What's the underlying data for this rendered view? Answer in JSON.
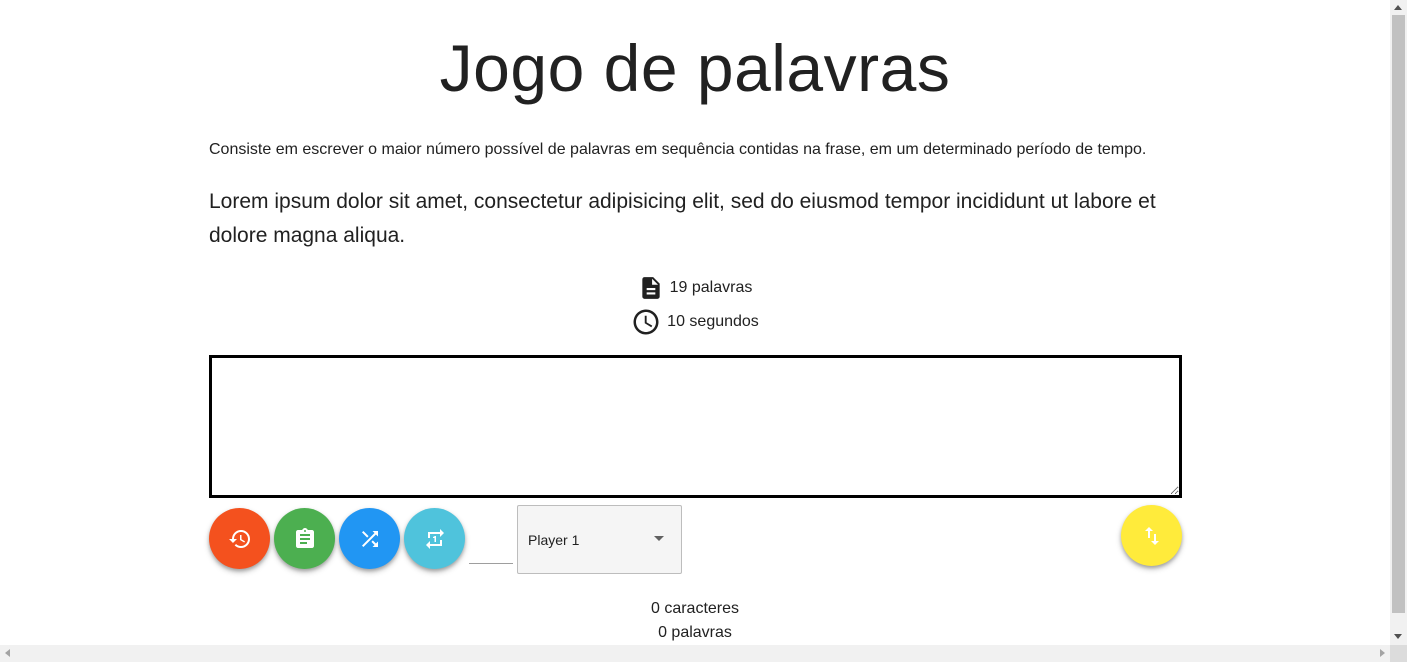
{
  "page": {
    "title": "Jogo de palavras",
    "description": "Consiste em escrever o maior número possível de palavras em sequência contidas na frase, em um determinado período de tempo.",
    "phrase": "Lorem ipsum dolor sit amet, consectetur adipisicing elit, sed do eiusmod tempor incididunt ut labore et dolore magna aliqua."
  },
  "stats": {
    "words": "19 palavras",
    "words_icon": "document-icon",
    "time": "10 segundos",
    "time_icon": "clock-icon"
  },
  "typing": {
    "value": "",
    "placeholder": ""
  },
  "actions": {
    "history": {
      "icon": "history-icon",
      "color": "#f4511e"
    },
    "paste": {
      "icon": "clipboard-icon",
      "color": "#4caf50"
    },
    "shuffle": {
      "icon": "shuffle-icon",
      "color": "#2196f3"
    },
    "repeat": {
      "icon": "repeat-one-icon",
      "color": "#4fc3dc"
    },
    "swap": {
      "icon": "swap-vertical-icon",
      "color": "#ffeb3b"
    }
  },
  "small_input": {
    "value": ""
  },
  "player_select": {
    "selected": "Player 1"
  },
  "counters": {
    "characters": "0 caracteres",
    "words": "0 palavras"
  }
}
